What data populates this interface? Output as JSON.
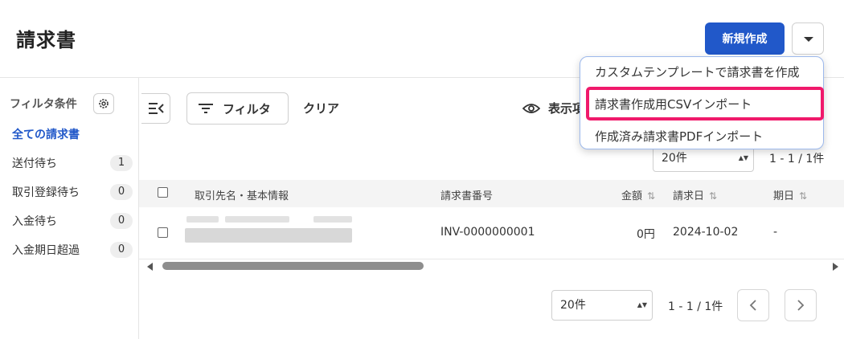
{
  "header": {
    "title": "請求書",
    "new_button": "新規作成"
  },
  "dropdown_menu": {
    "items": [
      "カスタムテンプレートで請求書を作成",
      "請求書作成用CSVインポート",
      "作成済み請求書PDFインポート"
    ],
    "highlighted_index": 1,
    "highlight_color": "#f0196b"
  },
  "sidebar": {
    "title": "フィルタ条件",
    "items": [
      {
        "label": "全ての請求書",
        "count": ""
      },
      {
        "label": "送付待ち",
        "count": "1"
      },
      {
        "label": "取引登録待ち",
        "count": "0"
      },
      {
        "label": "入金待ち",
        "count": "0"
      },
      {
        "label": "入金期日超過",
        "count": "0"
      }
    ]
  },
  "toolbar": {
    "filter": "フィルタ",
    "clear": "クリア",
    "display": "表示項目"
  },
  "pagination": {
    "page_size": "20件",
    "range": "1 - 1 / 1件"
  },
  "table": {
    "columns": [
      "取引先名・基本情報",
      "請求書番号",
      "金額",
      "請求日",
      "期日"
    ],
    "rows": [
      {
        "number": "INV-0000000001",
        "amount": "0円",
        "date": "2024-10-02",
        "due": "-"
      }
    ]
  },
  "colors": {
    "primary": "#2158c9",
    "accent_border": "#9db9ec"
  }
}
